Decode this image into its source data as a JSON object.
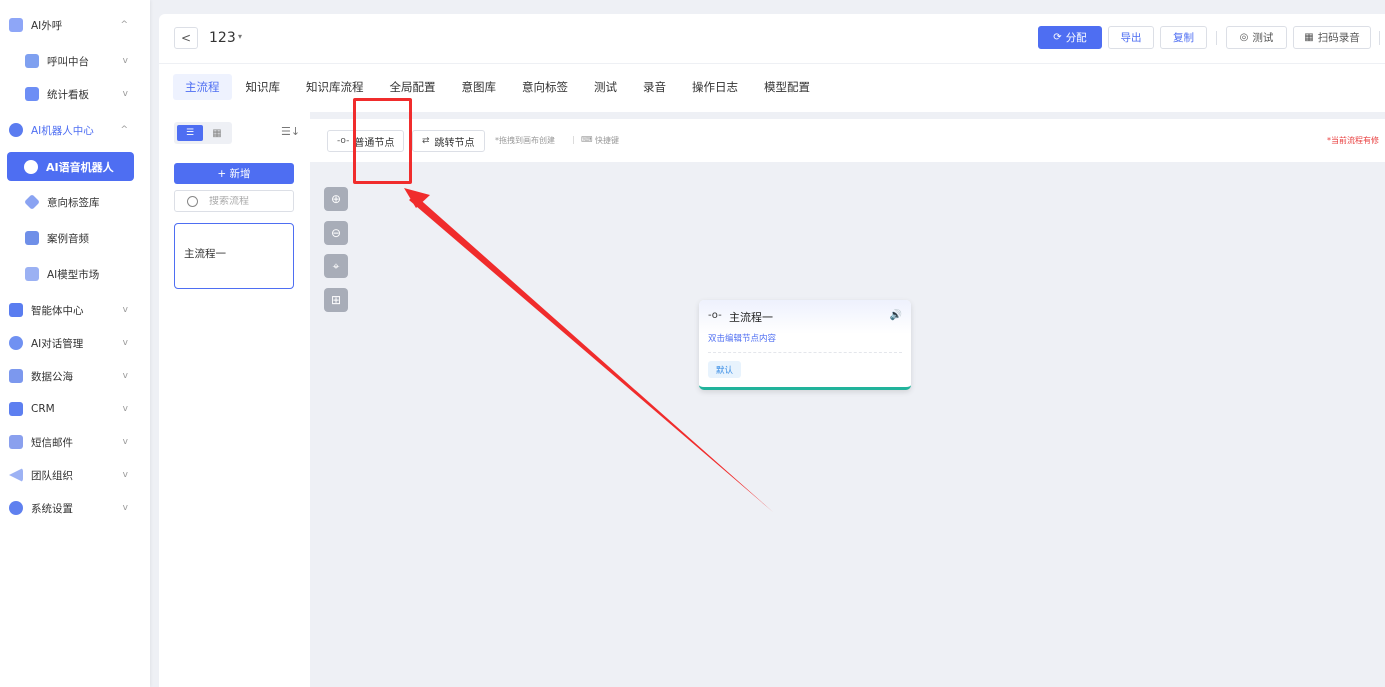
{
  "sidebar": {
    "items": [
      {
        "label": "AI外呼",
        "icon": "user-icon",
        "level": "top",
        "chevron": "^"
      },
      {
        "label": "呼叫中台",
        "icon": "user-icon",
        "level": "sub",
        "chevron": "v"
      },
      {
        "label": "统计看板",
        "icon": "chart-icon",
        "level": "sub",
        "chevron": "v"
      },
      {
        "label": "AI机器人中心",
        "icon": "robot-icon",
        "level": "top",
        "chevron": "^"
      },
      {
        "label": "AI语音机器人",
        "icon": "robot-icon",
        "level": "sub",
        "active": true
      },
      {
        "label": "意向标签库",
        "icon": "tag-icon",
        "level": "sub"
      },
      {
        "label": "案例音频",
        "icon": "folder-icon",
        "level": "sub"
      },
      {
        "label": "AI模型市场",
        "icon": "model-icon",
        "level": "sub"
      },
      {
        "label": "智能体中心",
        "icon": "agent-icon",
        "level": "top",
        "chevron": "v"
      },
      {
        "label": "AI对话管理",
        "icon": "chat-icon",
        "level": "top",
        "chevron": "v"
      },
      {
        "label": "数据公海",
        "icon": "data-icon",
        "level": "top",
        "chevron": "v"
      },
      {
        "label": "CRM",
        "icon": "crm-icon",
        "level": "top",
        "chevron": "v"
      },
      {
        "label": "短信邮件",
        "icon": "mail-icon",
        "level": "top",
        "chevron": "v"
      },
      {
        "label": "团队组织",
        "icon": "team-icon",
        "level": "top",
        "chevron": "v"
      },
      {
        "label": "系统设置",
        "icon": "settings-icon",
        "level": "top",
        "chevron": "v"
      }
    ]
  },
  "topbar": {
    "back_icon": "<",
    "project_name": "123",
    "caret": "▾",
    "buttons": {
      "assign": "分配",
      "export": "导出",
      "copy": "复制",
      "test": "测试",
      "scan_record": "扫码录音"
    }
  },
  "tabs": [
    "主流程",
    "知识库",
    "知识库流程",
    "全局配置",
    "意图库",
    "意向标签",
    "测试",
    "录音",
    "操作日志",
    "模型配置"
  ],
  "active_tab": "主流程",
  "flow_panel": {
    "add_label": "+ 新增",
    "search_placeholder": "搜索流程",
    "flows": [
      "主流程一"
    ]
  },
  "canvas": {
    "normal_node_btn": "普通节点",
    "jump_node_btn": "跳转节点",
    "drag_hint": "*拖拽到画布创建",
    "shortcut_label": "快捷键",
    "warning": "*当前流程有修",
    "node": {
      "tag": "-o-",
      "title": "主流程一",
      "desc": "双击编辑节点内容",
      "badge": "默认"
    }
  },
  "colors": {
    "primary": "#4e6ef2",
    "annotation": "#f02c2c",
    "node_bottom": "#21b39b"
  }
}
